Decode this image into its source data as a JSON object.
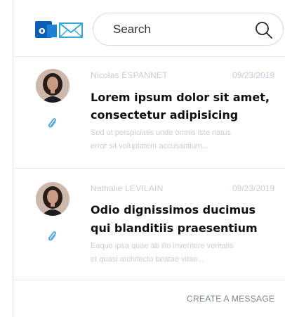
{
  "search": {
    "placeholder": "Search",
    "value": ""
  },
  "messages": [
    {
      "sender": "Nicolas ESPANNET",
      "date": "09/23/2019",
      "subject_line1": "Lorem ipsum dolor sit amet,",
      "subject_line2": "consectetur adipisicing",
      "preview_line1": "Sed ut perspiciatis unde omnis iste natus",
      "preview_line2": "error sit voluptatem accusantium...",
      "has_attachment": true
    },
    {
      "sender": "Nathalie LEVILAIN",
      "date": "09/23/2019",
      "subject_line1": "Odio dignissimos ducimus",
      "subject_line2": "qui blanditiis praesentium",
      "preview_line1": "Eaque ipsa quae ab illo inventore veritatis",
      "preview_line2": "et quasi architecto beatae vitae...",
      "has_attachment": true
    }
  ],
  "footer": {
    "create_label": "CREATE A MESSAGE"
  },
  "colors": {
    "outlook_blue": "#0a5fb4",
    "mail_teal": "#35a9d6",
    "attachment": "#5aa8e0"
  }
}
